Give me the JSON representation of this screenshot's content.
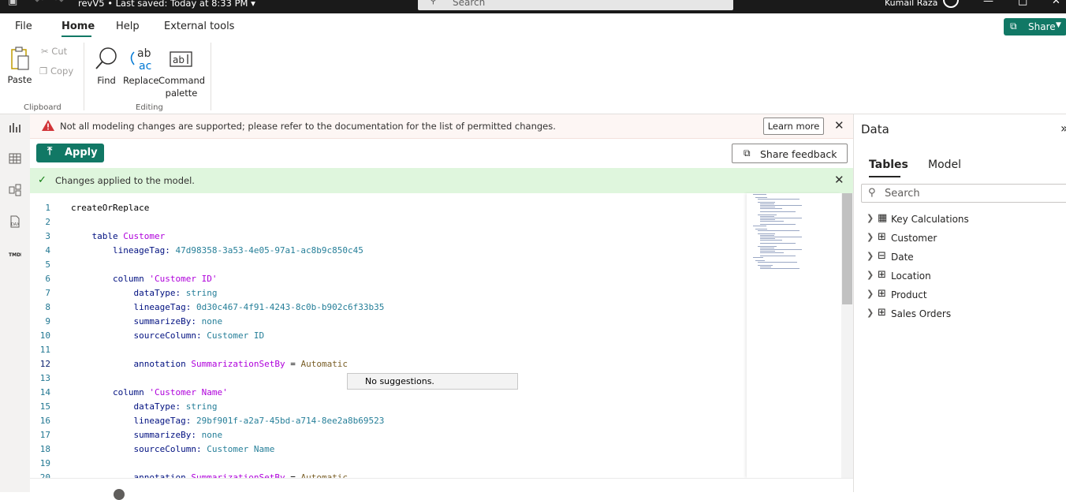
{
  "titlebar": {
    "title": "revV5 • Last saved: Today at 8:33 PM",
    "search_placeholder": "Search",
    "user_name": "Kumail Raza",
    "icons": [
      "save-icon",
      "undo-icon",
      "redo-icon",
      "minimize-icon",
      "maximize-icon",
      "close-icon"
    ]
  },
  "menu": {
    "tabs": [
      "File",
      "Home",
      "Help",
      "External tools"
    ],
    "active": "Home",
    "share_label": "Share"
  },
  "ribbon": {
    "paste": "Paste",
    "cut": "Cut",
    "copy": "Copy",
    "clipboard_group": "Clipboard",
    "find": "Find",
    "replace": "Replace",
    "command_palette_line1": "Command",
    "command_palette_line2": "palette",
    "editing_group": "Editing"
  },
  "warning": {
    "text": "Not all modeling changes are supported; please refer to the documentation for the list of permitted changes.",
    "learn_more": "Learn more"
  },
  "toolbar": {
    "apply": "Apply",
    "share_feedback": "Share feedback"
  },
  "success": {
    "text": "Changes applied to the model."
  },
  "editor": {
    "suggestion": "No suggestions.",
    "current_line": 12,
    "lines": [
      {
        "n": "1",
        "indent": 0,
        "tokens": [
          [
            "k-plain",
            "createOrReplace"
          ]
        ]
      },
      {
        "n": "2",
        "indent": 0,
        "tokens": []
      },
      {
        "n": "3",
        "indent": 1,
        "tokens": [
          [
            "k-key",
            "table "
          ],
          [
            "k-purple",
            "Customer"
          ]
        ]
      },
      {
        "n": "4",
        "indent": 2,
        "tokens": [
          [
            "k-key",
            "lineageTag: "
          ],
          [
            "k-type",
            "47d98358-3a53-4e05-97a1-ac8b9c850c45"
          ]
        ]
      },
      {
        "n": "5",
        "indent": 0,
        "tokens": []
      },
      {
        "n": "6",
        "indent": 2,
        "tokens": [
          [
            "k-key",
            "column "
          ],
          [
            "k-purple",
            "'Customer ID'"
          ]
        ]
      },
      {
        "n": "7",
        "indent": 3,
        "tokens": [
          [
            "k-key",
            "dataType: "
          ],
          [
            "k-type",
            "string"
          ]
        ]
      },
      {
        "n": "8",
        "indent": 3,
        "tokens": [
          [
            "k-key",
            "lineageTag: "
          ],
          [
            "k-type",
            "0d30c467-4f91-4243-8c0b-b902c6f33b35"
          ]
        ]
      },
      {
        "n": "9",
        "indent": 3,
        "tokens": [
          [
            "k-key",
            "summarizeBy: "
          ],
          [
            "k-type",
            "none"
          ]
        ]
      },
      {
        "n": "10",
        "indent": 3,
        "tokens": [
          [
            "k-key",
            "sourceColumn: "
          ],
          [
            "k-type",
            "Customer ID"
          ]
        ]
      },
      {
        "n": "11",
        "indent": 0,
        "tokens": []
      },
      {
        "n": "12",
        "indent": 3,
        "tokens": [
          [
            "k-key",
            "annotation "
          ],
          [
            "k-purple",
            "SummarizationSetBy"
          ],
          [
            "k-plain",
            " = "
          ],
          [
            "k-name",
            "Automatic"
          ]
        ]
      },
      {
        "n": "13",
        "indent": 0,
        "tokens": []
      },
      {
        "n": "14",
        "indent": 2,
        "tokens": [
          [
            "k-key",
            "column "
          ],
          [
            "k-purple",
            "'Customer Name'"
          ]
        ]
      },
      {
        "n": "15",
        "indent": 3,
        "tokens": [
          [
            "k-key",
            "dataType: "
          ],
          [
            "k-type",
            "string"
          ]
        ]
      },
      {
        "n": "16",
        "indent": 3,
        "tokens": [
          [
            "k-key",
            "lineageTag: "
          ],
          [
            "k-type",
            "29bf901f-a2a7-45bd-a714-8ee2a8b69523"
          ]
        ]
      },
      {
        "n": "17",
        "indent": 3,
        "tokens": [
          [
            "k-key",
            "summarizeBy: "
          ],
          [
            "k-type",
            "none"
          ]
        ]
      },
      {
        "n": "18",
        "indent": 3,
        "tokens": [
          [
            "k-key",
            "sourceColumn: "
          ],
          [
            "k-type",
            "Customer Name"
          ]
        ]
      },
      {
        "n": "19",
        "indent": 0,
        "tokens": []
      },
      {
        "n": "20",
        "indent": 3,
        "tokens": [
          [
            "k-key",
            "annotation "
          ],
          [
            "k-purple",
            "SummarizationSetBy"
          ],
          [
            "k-plain",
            " = "
          ],
          [
            "k-name",
            "Automatic"
          ]
        ]
      }
    ]
  },
  "datapane": {
    "title": "Data",
    "tabs": [
      "Tables",
      "Model"
    ],
    "active_tab": "Tables",
    "search_placeholder": "Search",
    "tables": [
      {
        "name": "Key Calculations",
        "icon": "calculator-icon"
      },
      {
        "name": "Customer",
        "icon": "table-icon"
      },
      {
        "name": "Date",
        "icon": "date-table-icon"
      },
      {
        "name": "Location",
        "icon": "table-icon"
      },
      {
        "name": "Product",
        "icon": "table-icon"
      },
      {
        "name": "Sales Orders",
        "icon": "table-icon"
      }
    ]
  },
  "colors": {
    "accent": "#117865",
    "success_bg": "#dff6dd",
    "warning_bg": "#fdf6f4",
    "warning_icon": "#d13438"
  }
}
